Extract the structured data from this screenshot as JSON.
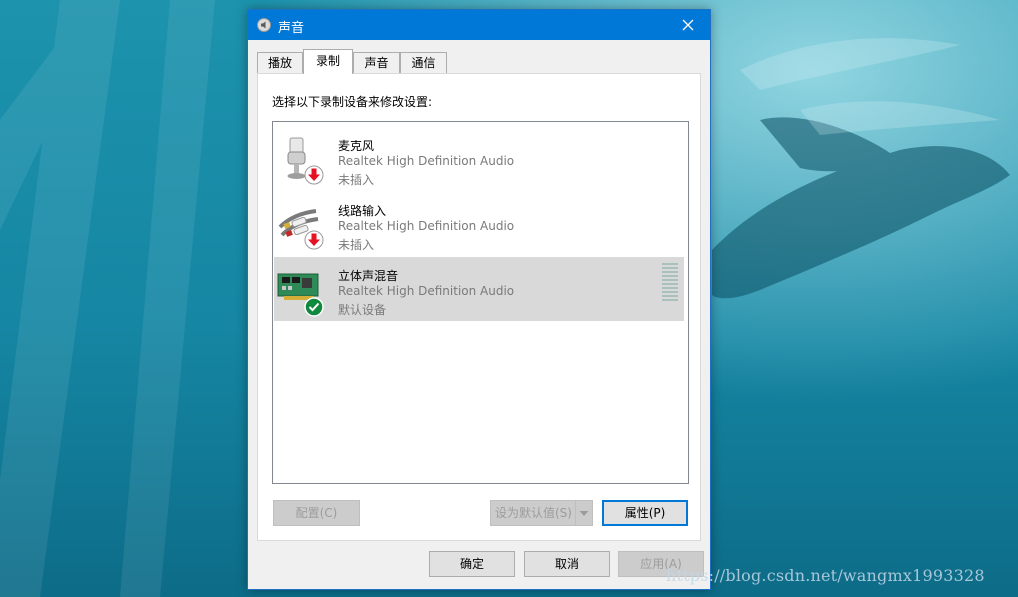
{
  "window": {
    "title": "声音",
    "tabs": [
      {
        "label": "播放",
        "active": false
      },
      {
        "label": "录制",
        "active": true
      },
      {
        "label": "声音",
        "active": false
      },
      {
        "label": "通信",
        "active": false
      }
    ],
    "instruction": "选择以下录制设备来修改设置:",
    "devices": [
      {
        "name": "麦克风",
        "description": "Realtek High Definition Audio",
        "status": "未插入",
        "icon": "microphone-icon",
        "badge": "unplugged-arrow-icon",
        "selected": false
      },
      {
        "name": "线路输入",
        "description": "Realtek High Definition Audio",
        "status": "未插入",
        "icon": "line-in-cable-icon",
        "badge": "unplugged-arrow-icon",
        "selected": false
      },
      {
        "name": "立体声混音",
        "description": "Realtek High Definition Audio",
        "status": "默认设备",
        "icon": "sound-card-icon",
        "badge": "default-check-icon",
        "selected": true
      }
    ],
    "buttons": {
      "configure": "配置(C)",
      "set_default": "设为默认值(S)",
      "properties": "属性(P)",
      "ok": "确定",
      "cancel": "取消",
      "apply": "应用(A)"
    }
  },
  "watermark": "https://blog.csdn.net/wangmx1993328",
  "colors": {
    "titlebar": "#0078d7",
    "selection": "#d9d9d9",
    "focus_border": "#0078d7",
    "unplugged_badge": "#e81123",
    "default_badge": "#10893e"
  }
}
